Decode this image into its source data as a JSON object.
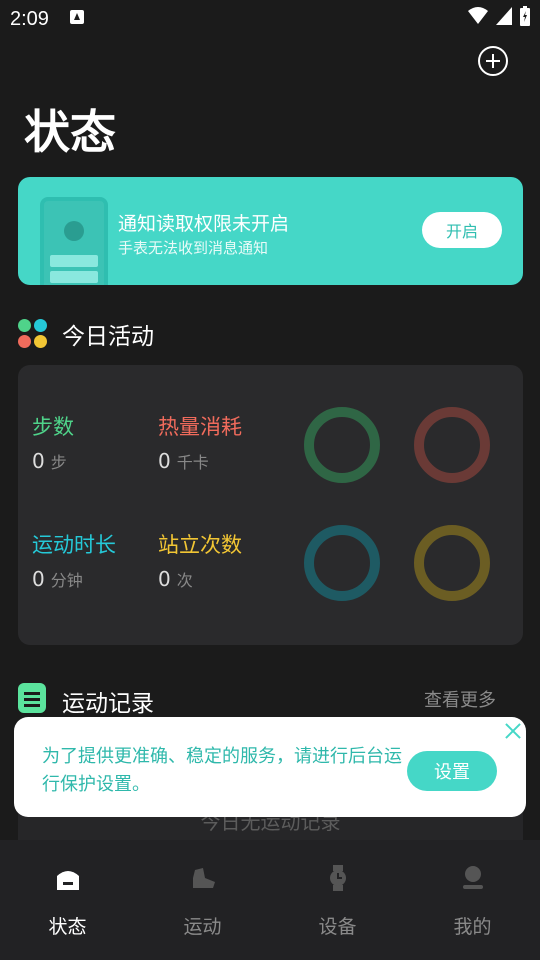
{
  "status_bar": {
    "time": "2:09"
  },
  "header": {
    "title": "状态"
  },
  "notice": {
    "title": "通知读取权限未开启",
    "subtitle": "手表无法收到消息通知",
    "button": "开启"
  },
  "today": {
    "title": "今日活动",
    "metrics": [
      {
        "label": "步数",
        "value": "0",
        "unit": "步",
        "color": "#4fd38a"
      },
      {
        "label": "热量消耗",
        "value": "0",
        "unit": "千卡",
        "color": "#f06b5c"
      },
      {
        "label": "运动时长",
        "value": "0",
        "unit": "分钟",
        "color": "#25c9d8"
      },
      {
        "label": "站立次数",
        "value": "0",
        "unit": "次",
        "color": "#f2c634"
      }
    ]
  },
  "records": {
    "title": "运动记录",
    "more": "查看更多",
    "empty": "今日无运动记录"
  },
  "popup": {
    "text": "为了提供更准确、稳定的服务，请进行后台运行保护设置。",
    "button": "设置"
  },
  "tabs": [
    {
      "label": "状态",
      "icon": "home-icon",
      "active": true
    },
    {
      "label": "运动",
      "icon": "shoe-icon",
      "active": false
    },
    {
      "label": "设备",
      "icon": "watch-icon",
      "active": false
    },
    {
      "label": "我的",
      "icon": "profile-icon",
      "active": false
    }
  ]
}
